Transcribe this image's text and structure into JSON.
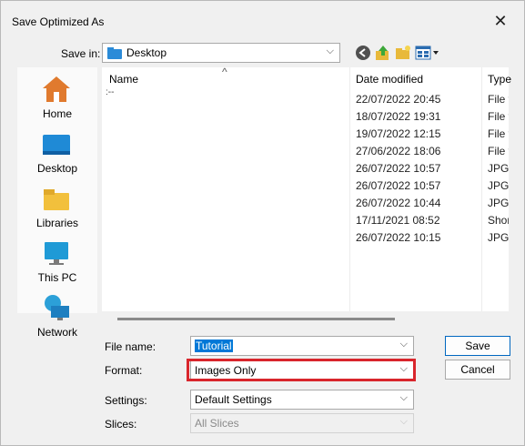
{
  "window": {
    "title": "Save Optimized As"
  },
  "save_in": {
    "label": "Save in:",
    "value": "Desktop"
  },
  "places": [
    {
      "label": "Home",
      "icon": "home-icon"
    },
    {
      "label": "Desktop",
      "icon": "desktop-icon"
    },
    {
      "label": "Libraries",
      "icon": "libraries-icon"
    },
    {
      "label": "This PC",
      "icon": "this-pc-icon"
    },
    {
      "label": "Network",
      "icon": "network-icon"
    }
  ],
  "columns": {
    "name": "Name",
    "date": "Date modified",
    "type": "Type"
  },
  "rows": [
    {
      "name": "",
      "date": "22/07/2022 20:45",
      "type": "File fo"
    },
    {
      "name": "",
      "date": "18/07/2022 19:31",
      "type": "File fo"
    },
    {
      "name": "",
      "date": "19/07/2022 12:15",
      "type": "File fo"
    },
    {
      "name": "",
      "date": "27/06/2022 18:06",
      "type": "File fo"
    },
    {
      "name": "",
      "date": "26/07/2022 10:57",
      "type": "JPG F"
    },
    {
      "name": "",
      "date": "26/07/2022 10:57",
      "type": "JPG F"
    },
    {
      "name": "",
      "date": "26/07/2022 10:44",
      "type": "JPG F"
    },
    {
      "name": "",
      "date": "17/11/2021 08:52",
      "type": "Short"
    },
    {
      "name": "",
      "date": "26/07/2022 10:15",
      "type": "JPG F"
    }
  ],
  "file_name": {
    "label": "File name:",
    "value": "Tutorial"
  },
  "format": {
    "label": "Format:",
    "value": "Images Only"
  },
  "settings": {
    "label": "Settings:",
    "value": "Default Settings"
  },
  "slices": {
    "label": "Slices:",
    "value": "All Slices"
  },
  "buttons": {
    "save": "Save",
    "cancel": "Cancel"
  },
  "colors": {
    "highlight": "#d9262c",
    "accent": "#0078d7"
  }
}
